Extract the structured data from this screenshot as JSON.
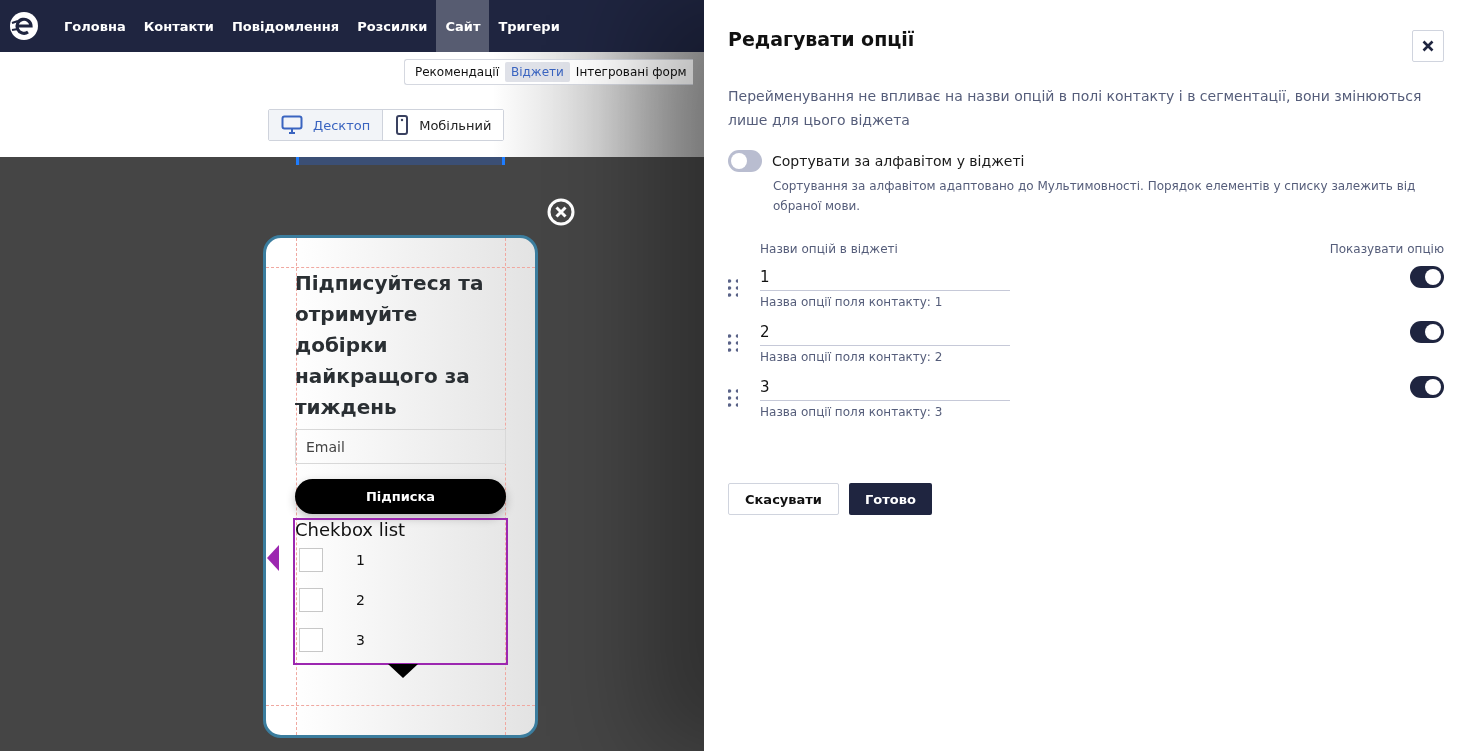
{
  "nav": {
    "items": [
      {
        "label": "Головна",
        "selected": false
      },
      {
        "label": "Контакти",
        "selected": false
      },
      {
        "label": "Повідомлення",
        "selected": false
      },
      {
        "label": "Розсилки",
        "selected": false
      },
      {
        "label": "Сайт",
        "selected": true
      },
      {
        "label": "Тригери",
        "selected": false
      }
    ]
  },
  "subtabs": [
    {
      "label": "Рекомендації",
      "selected": false
    },
    {
      "label": "Віджети",
      "selected": true
    },
    {
      "label": "Інтегровані форм",
      "selected": false
    }
  ],
  "devices": [
    {
      "label": "Десктоп",
      "kind": "desktop",
      "selected": true
    },
    {
      "label": "Мобільний",
      "kind": "mobile",
      "selected": false
    }
  ],
  "widget": {
    "title": "Підписуйтеся та отримуйте добірки найкращого за тиждень",
    "email": {
      "placeholder": "Email"
    },
    "button": "Підписка",
    "checkbox_list": {
      "title": "Chekbox list",
      "items": [
        {
          "label": "1",
          "checked": false
        },
        {
          "label": "2",
          "checked": false
        },
        {
          "label": "3",
          "checked": false
        }
      ]
    }
  },
  "panel": {
    "title": "Редагувати опції",
    "description": "Перейменування не впливає на назви опцій в полі контакту і в сегментації, вони змінюються лише для цього віджета",
    "sort": {
      "label": "Сортувати за алфавітом у віджеті",
      "on": false,
      "hint": "Сортування за алфавітом адаптовано до Мультимовності. Порядок елементів у списку залежить від обраної мови."
    },
    "columns": [
      "Назви опцій в віджеті",
      "Показувати опцію"
    ],
    "options": [
      {
        "value": "1",
        "note": "Назва опції поля контакту: 1",
        "on": true
      },
      {
        "value": "2",
        "note": "Назва опції поля контакту: 2",
        "on": true
      },
      {
        "value": "3",
        "note": "Назва опції поля контакту: 3",
        "on": true
      }
    ],
    "buttons": {
      "cancel": "Скасувати",
      "done": "Готово"
    }
  }
}
